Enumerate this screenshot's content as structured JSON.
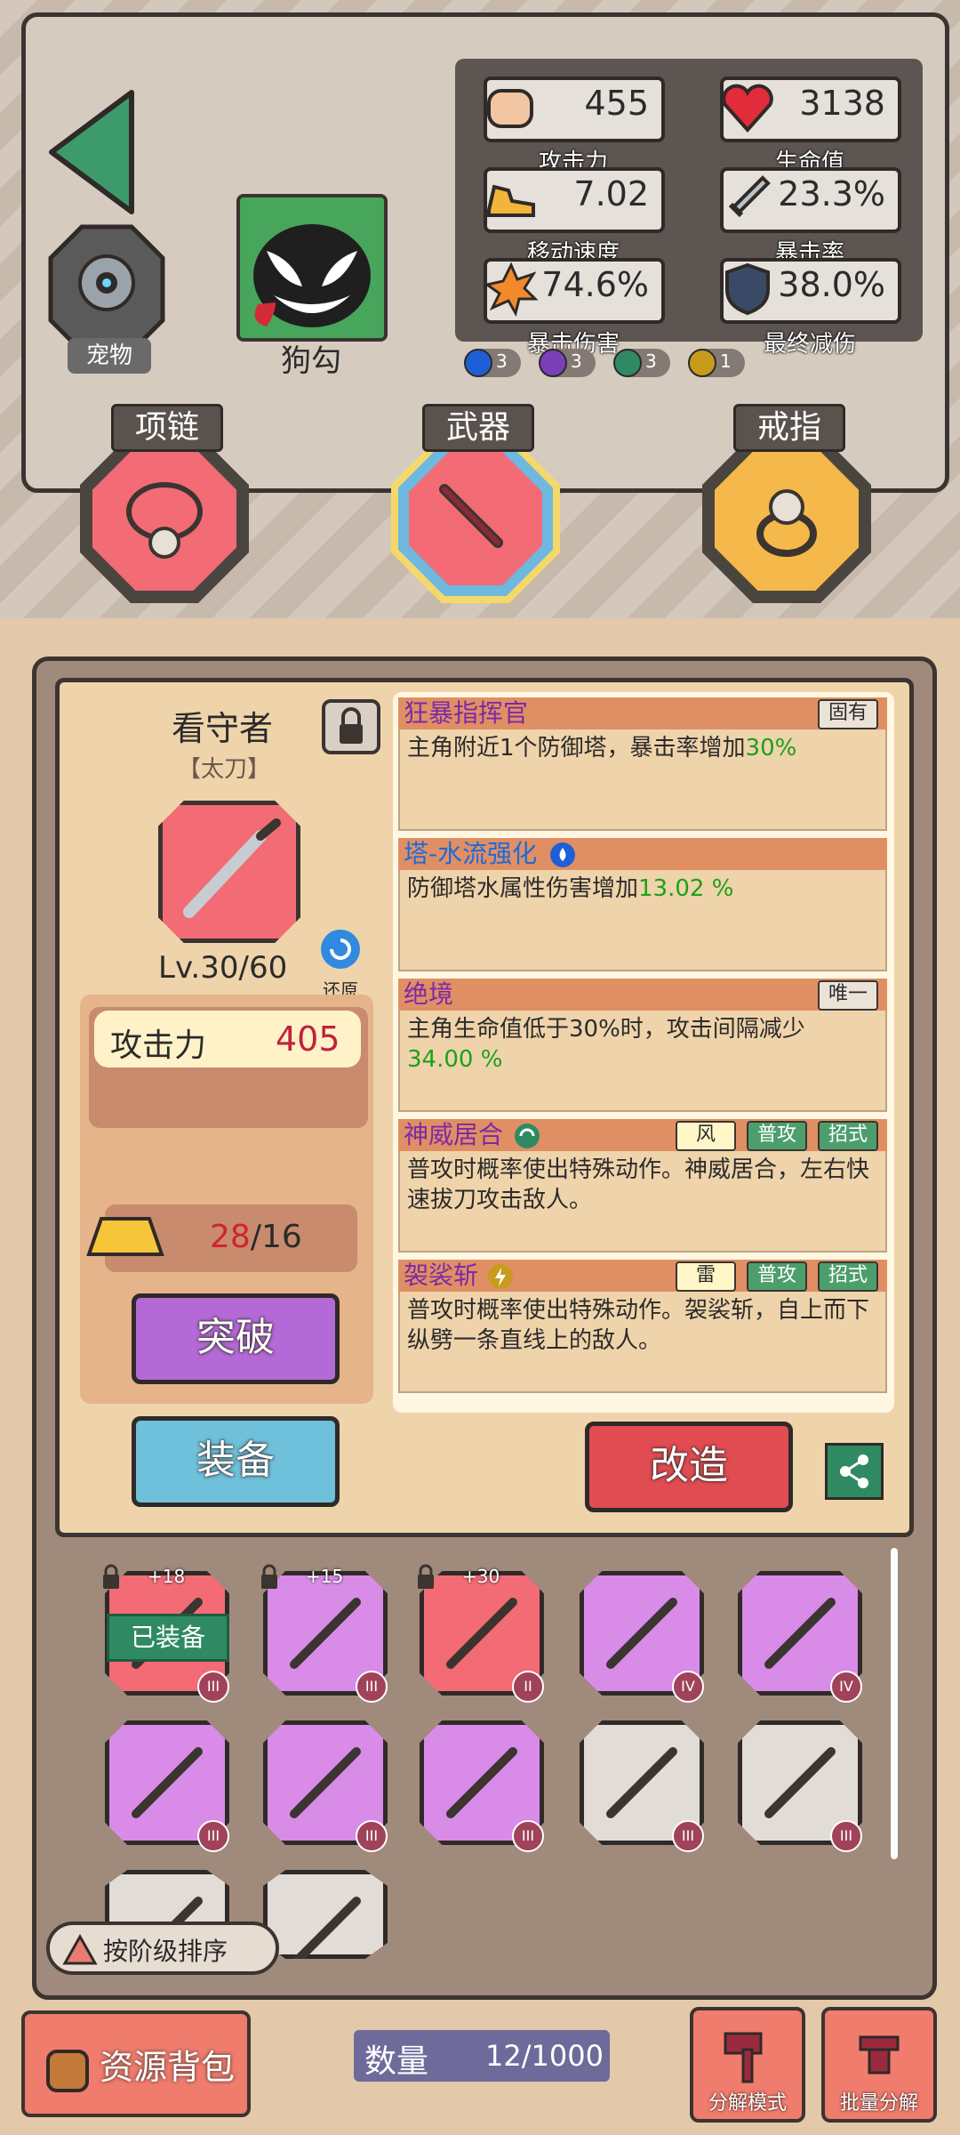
{
  "pet": {
    "label": "宠物"
  },
  "character": {
    "name": "狗勾"
  },
  "stats": [
    {
      "key": "attack",
      "value": "455",
      "label": "攻击力",
      "icon": "fist-icon"
    },
    {
      "key": "hp",
      "value": "3138",
      "label": "生命值",
      "icon": "heart-icon"
    },
    {
      "key": "move",
      "value": "7.02",
      "label": "移动速度",
      "icon": "shoe-icon"
    },
    {
      "key": "crit",
      "value": "23.3%",
      "label": "暴击率",
      "icon": "sword-icon"
    },
    {
      "key": "critdmg",
      "value": "74.6%",
      "label": "暴击伤害",
      "icon": "explosion-icon"
    },
    {
      "key": "reduce",
      "value": "38.0%",
      "label": "最终减伤",
      "icon": "shield-icon"
    }
  ],
  "elements": [
    {
      "name": "water",
      "count": "3",
      "color": "#1f5fd6"
    },
    {
      "name": "dark",
      "count": "3",
      "color": "#7b3fb8"
    },
    {
      "name": "wind",
      "count": "3",
      "color": "#2f8a63"
    },
    {
      "name": "thunder",
      "count": "1",
      "color": "#c99b1c"
    }
  ],
  "slots": {
    "necklace": "项链",
    "weapon": "武器",
    "ring": "戒指"
  },
  "weapon": {
    "name": "看守者",
    "type": "【太刀】",
    "level": "Lv.30/60",
    "restore": "还原",
    "attack_label": "攻击力",
    "attack_value": "405",
    "gold_current": "28",
    "gold_total": "/16",
    "break_label": "突破",
    "equip_label": "装备",
    "forge_label": "改造"
  },
  "skills": [
    {
      "title": "狂暴指挥官",
      "tags": [
        "固有"
      ],
      "text": "主角附近1个防御塔，暴击率增加",
      "highlight": "30%"
    },
    {
      "title": "塔-水流强化",
      "tags": [],
      "text": "防御塔水属性伤害增加",
      "highlight": "13.02 %"
    },
    {
      "title": "绝境",
      "tags": [
        "唯一"
      ],
      "text": "主角生命值低于30%时，攻击间隔减少",
      "highlight": "34.00 %"
    },
    {
      "title": "神威居合",
      "tags": [
        "风",
        "普攻",
        "招式"
      ],
      "text": "普攻时概率使出特殊动作。神威居合，左右快速拔刀攻击敌人。",
      "highlight": ""
    },
    {
      "title": "袈裟斩",
      "tags": [
        "雷",
        "普攻",
        "招式"
      ],
      "text": "普攻时概率使出特殊动作。袈裟斩，自上而下纵劈一条直线上的敌人。",
      "highlight": ""
    }
  ],
  "inventory": {
    "items": [
      {
        "color": "#f26b75",
        "plus": "+18",
        "tier": "III",
        "equipped": true
      },
      {
        "color": "#d98be8",
        "plus": "+15",
        "tier": "III",
        "equipped": false
      },
      {
        "color": "#f26b75",
        "plus": "+30",
        "tier": "II",
        "equipped": false
      },
      {
        "color": "#d98be8",
        "plus": "",
        "tier": "IV",
        "equipped": false
      },
      {
        "color": "#d98be8",
        "plus": "",
        "tier": "IV",
        "equipped": false
      },
      {
        "color": "#d98be8",
        "plus": "",
        "tier": "III",
        "equipped": false
      },
      {
        "color": "#d98be8",
        "plus": "",
        "tier": "III",
        "equipped": false
      },
      {
        "color": "#d98be8",
        "plus": "",
        "tier": "III",
        "equipped": false
      },
      {
        "color": "#e2dcd6",
        "plus": "",
        "tier": "III",
        "equipped": false
      },
      {
        "color": "#e2dcd6",
        "plus": "",
        "tier": "III",
        "equipped": false
      },
      {
        "color": "#e2dcd6",
        "plus": "",
        "tier": "",
        "equipped": false
      },
      {
        "color": "#e2dcd6",
        "plus": "",
        "tier": "",
        "equipped": false
      }
    ],
    "equipped_label": "已装备",
    "sort_label": "按阶级排序"
  },
  "bottom": {
    "resource_label": "资源背包",
    "count_label": "数量",
    "count_value": "12/1000",
    "decompose_label": "分解模式",
    "batch_label": "批量分解"
  }
}
